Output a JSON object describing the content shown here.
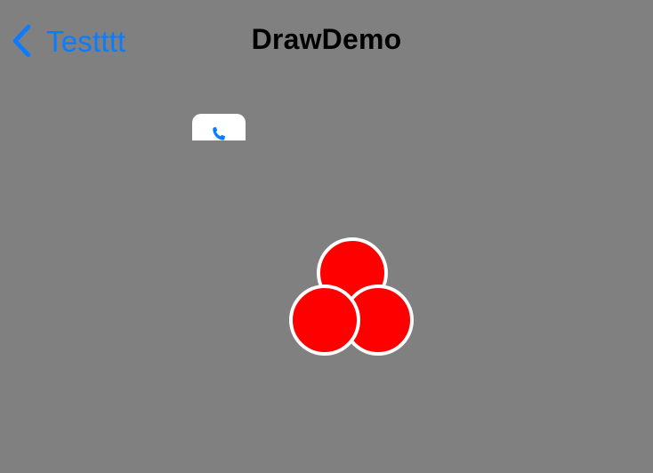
{
  "navbar": {
    "back_label": "Testttt",
    "title": "DrawDemo"
  },
  "icons": {
    "back": "chevron-left-icon",
    "call": "phone-icon"
  },
  "colors": {
    "background": "#808080",
    "accent": "#0a7cff",
    "shape_fill": "#ff0000",
    "shape_stroke": "#ffffff"
  }
}
